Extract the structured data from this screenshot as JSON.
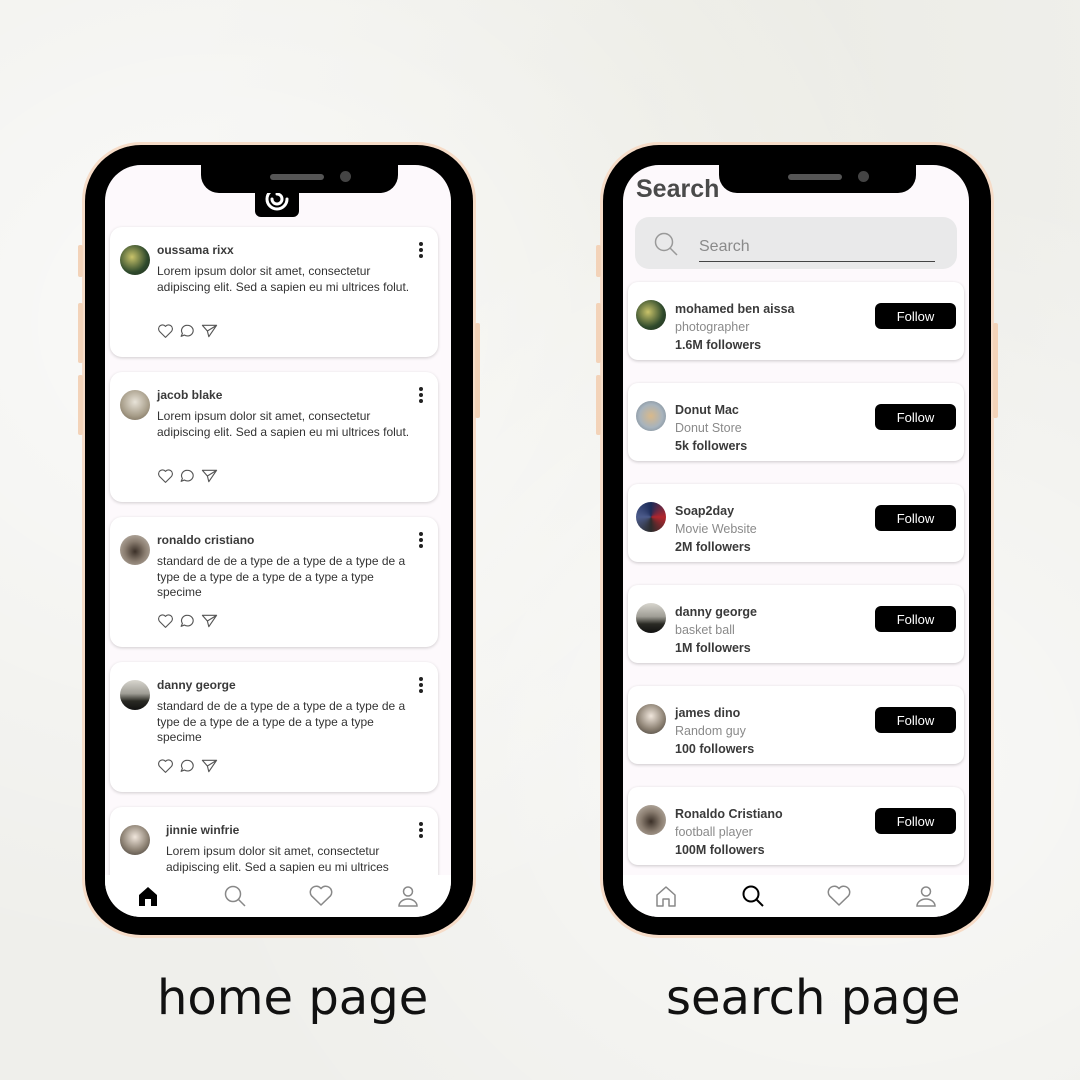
{
  "home": {
    "caption": "home page",
    "posts": [
      {
        "name": "oussama rixx",
        "text": "Lorem ipsum dolor sit amet, consectetur adipiscing elit. Sed a sapien eu mi ultrices folut."
      },
      {
        "name": "jacob blake",
        "text": "Lorem ipsum dolor sit amet, consectetur adipiscing elit. Sed a sapien eu mi ultrices folut."
      },
      {
        "name": "ronaldo cristiano",
        "text": "standard de  de a type  de a type  de a type de a type  de a type  de a type  de a type  a type specime"
      },
      {
        "name": "danny george",
        "text": "standard de  de a type  de a type  de a type de a type  de a type  de a type  de a type  a type specime"
      },
      {
        "name": "jinnie winfrie",
        "text": "Lorem ipsum dolor sit amet, consectetur adipiscing elit. Sed a sapien eu mi ultrices"
      }
    ]
  },
  "search": {
    "caption": "search page",
    "title": "Search",
    "placeholder": "Search",
    "follow_label": "Follow",
    "users": [
      {
        "name": "mohamed ben aissa",
        "role": "photographer",
        "followers": "1.6M followers"
      },
      {
        "name": "Donut Mac",
        "role": "Donut Store",
        "followers": "5k followers"
      },
      {
        "name": "Soap2day",
        "role": "Movie Website",
        "followers": "2M followers"
      },
      {
        "name": "danny george",
        "role": "basket ball",
        "followers": "1M followers"
      },
      {
        "name": "james dino",
        "role": "Random guy",
        "followers": "100 followers"
      },
      {
        "name": "Ronaldo Cristiano",
        "role": "football player",
        "followers": "100M followers"
      }
    ]
  },
  "nav": {
    "home_active": "home-icon",
    "search_active": "search-icon"
  }
}
